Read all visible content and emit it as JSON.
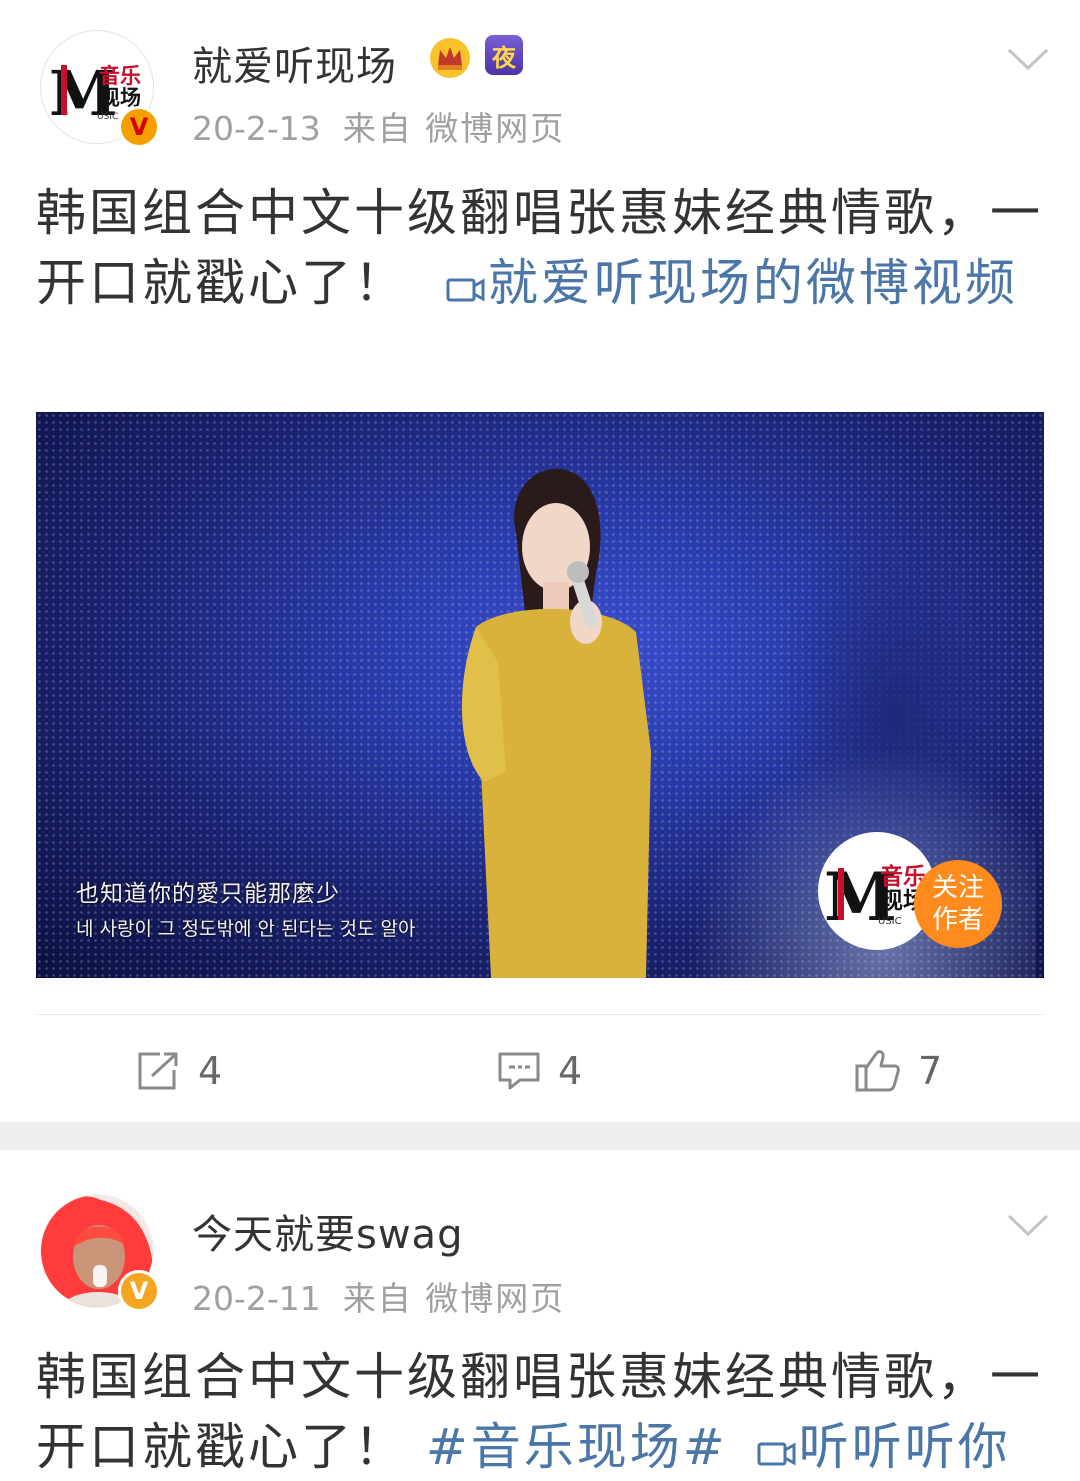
{
  "posts": [
    {
      "username": "就爱听现场",
      "date": "20-2-13",
      "source": "来自 微博网页",
      "avatar_logo": {
        "m": "M",
        "line1": "音乐",
        "line2": "现场",
        "sub": "USIC"
      },
      "badges": [
        "crown-icon",
        "night-badge"
      ],
      "night_badge_text": "夜",
      "verified": "V",
      "text": "韩国组合中文十级翻唱张惠妹经典情歌，一开口就戳心了！",
      "link_text": "就爱听现场的微博视频",
      "video": {
        "subtitle_cn": "也知道你的愛只能那麼少",
        "subtitle_kr": "네 사랑이 그 정도밖에 안 된다는 것도 알아",
        "follow_line1": "关注",
        "follow_line2": "作者"
      },
      "actions": {
        "repost": "4",
        "comment": "4",
        "like": "7"
      }
    },
    {
      "username": "今天就要swag",
      "date": "20-2-11",
      "source": "来自 微博网页",
      "verified": "V",
      "text": "韩国组合中文十级翻唱张惠妹经典情歌，一开口就戳心了！",
      "hashtag": "#音乐现场#",
      "link_text": "听听听你"
    }
  ],
  "colors": {
    "link": "#4a76a8",
    "verified_gold": "#f5a623",
    "follow_orange": "#ff8a1e",
    "separator": "#efefef"
  }
}
